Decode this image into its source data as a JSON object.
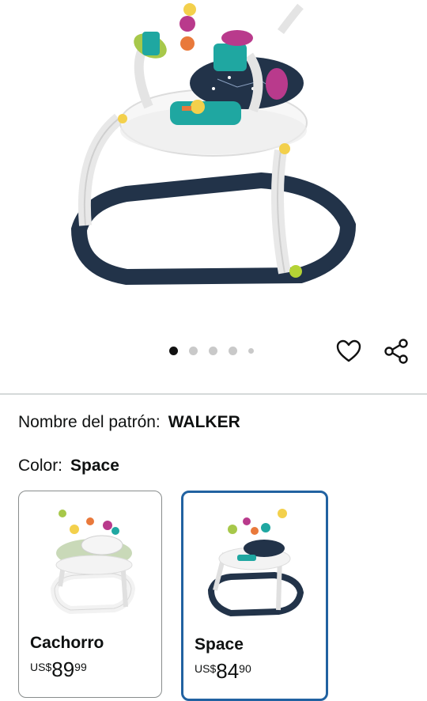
{
  "gallery": {
    "dots": [
      {
        "active": true
      },
      {
        "active": false
      },
      {
        "active": false
      },
      {
        "active": false
      },
      {
        "active": false,
        "small": true
      }
    ]
  },
  "details": {
    "pattern_label": "Nombre del patrón:",
    "pattern_value": "WALKER",
    "color_label": "Color:",
    "color_value": "Space"
  },
  "swatches": [
    {
      "name": "Cachorro",
      "currency": "US$",
      "whole": "89",
      "fraction": "99",
      "selected": false
    },
    {
      "name": "Space",
      "currency": "US$",
      "whole": "84",
      "fraction": "90",
      "selected": true
    }
  ],
  "colors": {
    "navy": "#223349",
    "selected_border": "#2162a1",
    "sage": "#c9d9b8"
  }
}
